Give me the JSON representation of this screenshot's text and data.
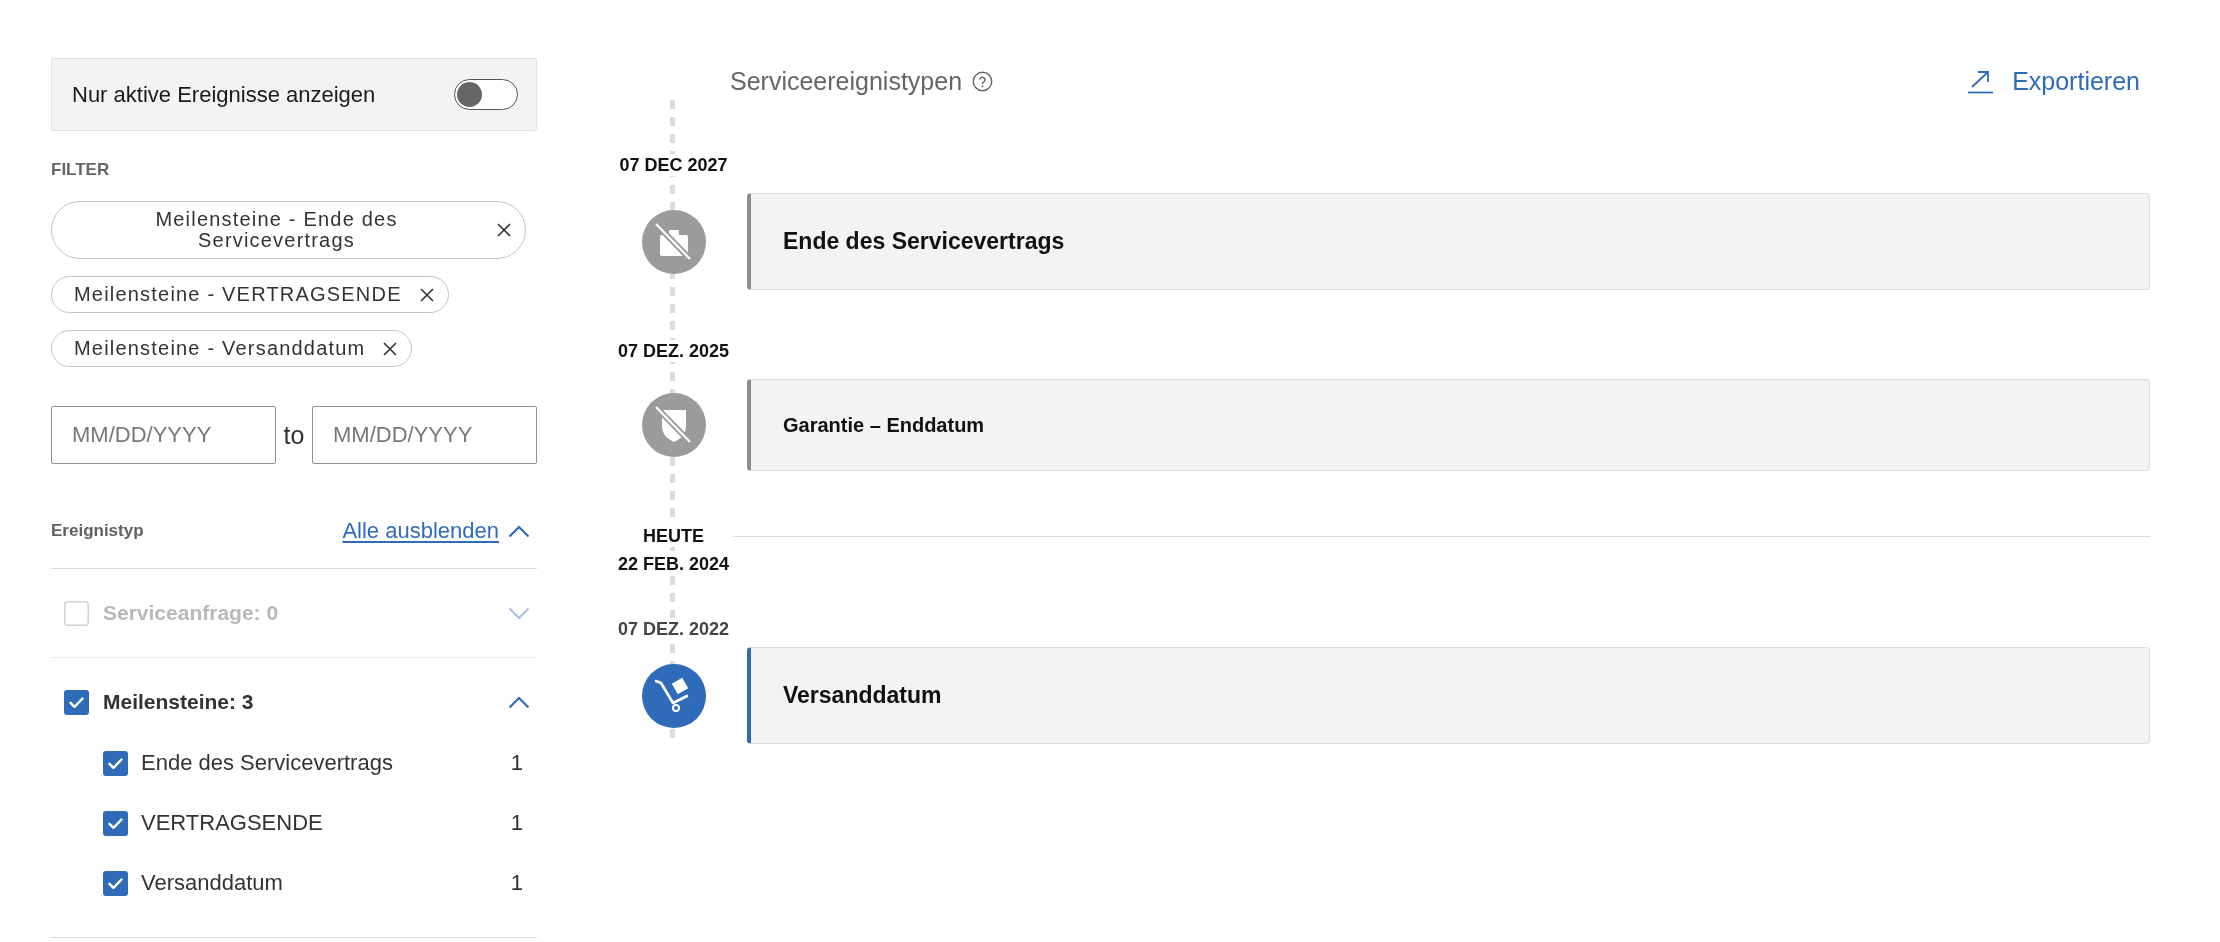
{
  "active_toggle": {
    "label": "Nur aktive Ereignisse anzeigen",
    "on": false
  },
  "filter": {
    "heading": "FILTER",
    "chips": [
      {
        "label": "Meilensteine - Ende des Servicevertrags"
      },
      {
        "label": "Meilensteine - VERTRAGSENDE"
      },
      {
        "label": "Meilensteine - Versanddatum"
      }
    ]
  },
  "date_range": {
    "from": {
      "placeholder": "MM/DD/YYYY"
    },
    "separator": "to",
    "to": {
      "placeholder": "MM/DD/YYYY"
    }
  },
  "event_types": {
    "heading": "Ereignistyp",
    "collapse_all": "Alle ausblenden",
    "groups": [
      {
        "label": "Serviceanfrage: 0",
        "checked": false,
        "disabled": true,
        "expanded": false
      },
      {
        "label": "Meilensteine: 3",
        "checked": true,
        "disabled": false,
        "expanded": true,
        "children": [
          {
            "label": "Ende des Servicevertrags",
            "count": "1",
            "checked": true
          },
          {
            "label": "VERTRAGSENDE",
            "count": "1",
            "checked": true
          },
          {
            "label": "Versanddatum",
            "count": "1",
            "checked": true
          }
        ]
      }
    ]
  },
  "timeline": {
    "title": "Serviceereignistypen",
    "export": "Exportieren",
    "entries": [
      {
        "kind": "contract-end",
        "date": "07 DEC 2027",
        "title": "Ende des Servicevertrags",
        "completed": false
      },
      {
        "kind": "warranty-end",
        "date": "07 DEZ. 2025",
        "title": "Garantie – Enddatum",
        "completed": false
      },
      {
        "kind": "today",
        "label": "HEUTE",
        "date": "22 FEB. 2024"
      },
      {
        "kind": "shipment",
        "date": "07 DEZ. 2022",
        "title": "Versanddatum",
        "completed": true
      }
    ]
  }
}
